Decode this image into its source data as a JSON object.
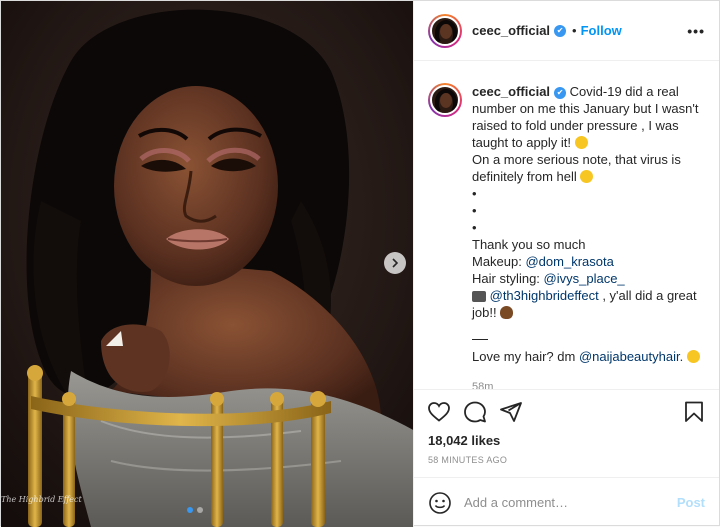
{
  "media": {
    "watermark": "The Highbrid Effect",
    "carousel_dots": 2,
    "active_dot": 0,
    "next_icon": "chevron-right-icon"
  },
  "header": {
    "username": "ceec_official",
    "verified": true,
    "separator": "•",
    "follow_label": "Follow",
    "more_label": "•••"
  },
  "caption": {
    "username": "ceec_official",
    "line1": " Covid-19 did a real number on me this January but I wasn't raised to fold under pressure , I was taught to apply it! ",
    "line2": "On a more serious note, that virus is definitely from hell ",
    "bullets": [
      "•",
      "•",
      "•"
    ],
    "thanks": "Thank you so much",
    "makeup_prefix": "Makeup: ",
    "makeup_mention": "@dom_krasota",
    "hair_prefix": "Hair styling: ",
    "hair_mention": "@ivys_place_",
    "photo_mention": "@th3highbrideffect",
    "photo_suffix": " , y'all did a great job!! ",
    "dash": "___",
    "promo_prefix": "Love my hair? dm ",
    "promo_mention": "@naijabeautyhair.",
    "time_ago": "58m"
  },
  "actions": {
    "like_icon": "heart-icon",
    "comment_icon": "comment-icon",
    "share_icon": "share-icon",
    "save_icon": "bookmark-icon"
  },
  "likes": "18,042 likes",
  "timestamp": "58 MINUTES AGO",
  "comment": {
    "placeholder": "Add a comment…",
    "post_label": "Post",
    "emoji_icon": "emoji-icon"
  },
  "colors": {
    "accent": "#0095f6",
    "verified": "#3897f0",
    "post_disabled": "#b2dffc",
    "mention": "#00376b"
  }
}
